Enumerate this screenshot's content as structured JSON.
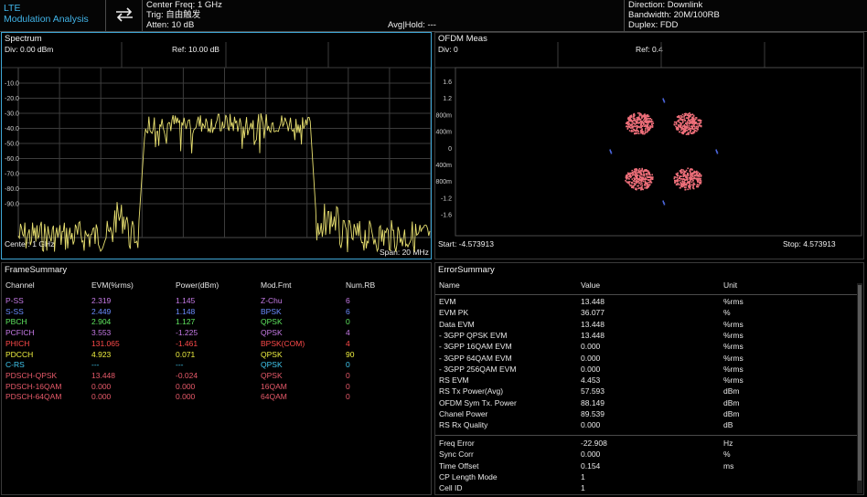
{
  "header": {
    "app_line1": "LTE",
    "app_line2": "Modulation Analysis",
    "center_freq": "Center Freq: 1 GHz",
    "trig": "Trig: 自由触发",
    "atten": "Atten: 10 dB",
    "avg_hold": "Avg|Hold: ---",
    "direction": "Direction: Downlink",
    "bandwidth": "Bandwidth: 20M/100RB",
    "duplex": "Duplex: FDD"
  },
  "spectrum": {
    "title": "Spectrum",
    "div": "Div: 0.00 dBm",
    "ref": "Ref: 10.00 dB",
    "center": "Center: 1 GHz",
    "span": "Span: 20 MHz",
    "y_ticks": [
      "-10.0",
      "-20.0",
      "-30.0",
      "-40.0",
      "-50.0",
      "-60.0",
      "-70.0",
      "-80.0",
      "-90.0"
    ],
    "trace_color": "#e8e070"
  },
  "ofdm": {
    "title": "OFDM Meas",
    "div": "Div: 0",
    "ref": "Ref: 0.4",
    "start": "Start: -4.573913",
    "stop": "Stop: 4.573913",
    "y_ticks": [
      "1.6",
      "1.2",
      "800m",
      "400m",
      "0",
      "-400m",
      "-800m",
      "-1.2",
      "-1.6"
    ],
    "constellation_color": "#ef6f7a",
    "pilot_color": "#4a63d8"
  },
  "frame_summary": {
    "title": "FrameSummary",
    "columns": [
      "Channel",
      "EVM(%rms)",
      "Power(dBm)",
      "Mod.Fmt",
      "Num.RB"
    ],
    "rows": [
      {
        "channel": "P-SS",
        "evm": "2.319",
        "power": "1.145",
        "mod": "Z-Chu",
        "rb": "6",
        "color": "#c77be8"
      },
      {
        "channel": "S-SS",
        "evm": "2.449",
        "power": "1.148",
        "mod": "BPSK",
        "rb": "6",
        "color": "#6b8cff"
      },
      {
        "channel": "PBCH",
        "evm": "2.904",
        "power": "1.127",
        "mod": "QPSK",
        "rb": "0",
        "color": "#5fe65f"
      },
      {
        "channel": "PCFICH",
        "evm": "3.553",
        "power": "-1.225",
        "mod": "QPSK",
        "rb": "4",
        "color": "#c77be8"
      },
      {
        "channel": "PHICH",
        "evm": "131.065",
        "power": "-1.461",
        "mod": "BPSK(COM)",
        "rb": "4",
        "color": "#ff4a4a"
      },
      {
        "channel": "PDCCH",
        "evm": "4.923",
        "power": "0.071",
        "mod": "QPSK",
        "rb": "90",
        "color": "#f0f040"
      },
      {
        "channel": "C-RS",
        "evm": "---",
        "power": "---",
        "mod": "QPSK",
        "rb": "0",
        "color": "#41c8f0"
      },
      {
        "channel": "PDSCH-QPSK",
        "evm": "13.448",
        "power": "-0.024",
        "mod": "QPSK",
        "rb": "0",
        "color": "#e85a6a"
      },
      {
        "channel": "PDSCH-16QAM",
        "evm": "0.000",
        "power": "0.000",
        "mod": "16QAM",
        "rb": "0",
        "color": "#e85a6a"
      },
      {
        "channel": "PDSCH-64QAM",
        "evm": "0.000",
        "power": "0.000",
        "mod": "64QAM",
        "rb": "0",
        "color": "#e85a6a"
      }
    ]
  },
  "error_summary": {
    "title": "ErrorSummary",
    "columns": [
      "Name",
      "Value",
      "Unit"
    ],
    "rows": [
      {
        "name": "EVM",
        "value": "13.448",
        "unit": "%rms"
      },
      {
        "name": "EVM PK",
        "value": "36.077",
        "unit": "%"
      },
      {
        "name": "Data EVM",
        "value": "13.448",
        "unit": "%rms"
      },
      {
        "name": " - 3GPP QPSK EVM",
        "value": "13.448",
        "unit": "%rms"
      },
      {
        "name": " - 3GPP 16QAM EVM",
        "value": "0.000",
        "unit": "%rms"
      },
      {
        "name": " - 3GPP 64QAM EVM",
        "value": "0.000",
        "unit": "%rms"
      },
      {
        "name": " - 3GPP 256QAM EVM",
        "value": "0.000",
        "unit": "%rms"
      },
      {
        "name": "RS EVM",
        "value": "4.453",
        "unit": "%rms"
      },
      {
        "name": "RS Tx Power(Avg)",
        "value": "57.593",
        "unit": "dBm"
      },
      {
        "name": "OFDM Sym Tx. Power",
        "value": "88.149",
        "unit": "dBm"
      },
      {
        "name": "Chanel Power",
        "value": "89.539",
        "unit": "dBm"
      },
      {
        "name": "RS Rx Quality",
        "value": "0.000",
        "unit": "dB"
      }
    ],
    "rows2": [
      {
        "name": "Freq Error",
        "value": "-22.908",
        "unit": "Hz"
      },
      {
        "name": "Sync Corr",
        "value": "0.000",
        "unit": "%"
      },
      {
        "name": "Time Offset",
        "value": "0.154",
        "unit": "ms"
      },
      {
        "name": "CP Length Mode",
        "value": "1",
        "unit": ""
      },
      {
        "name": "Cell ID",
        "value": "1",
        "unit": ""
      }
    ]
  }
}
